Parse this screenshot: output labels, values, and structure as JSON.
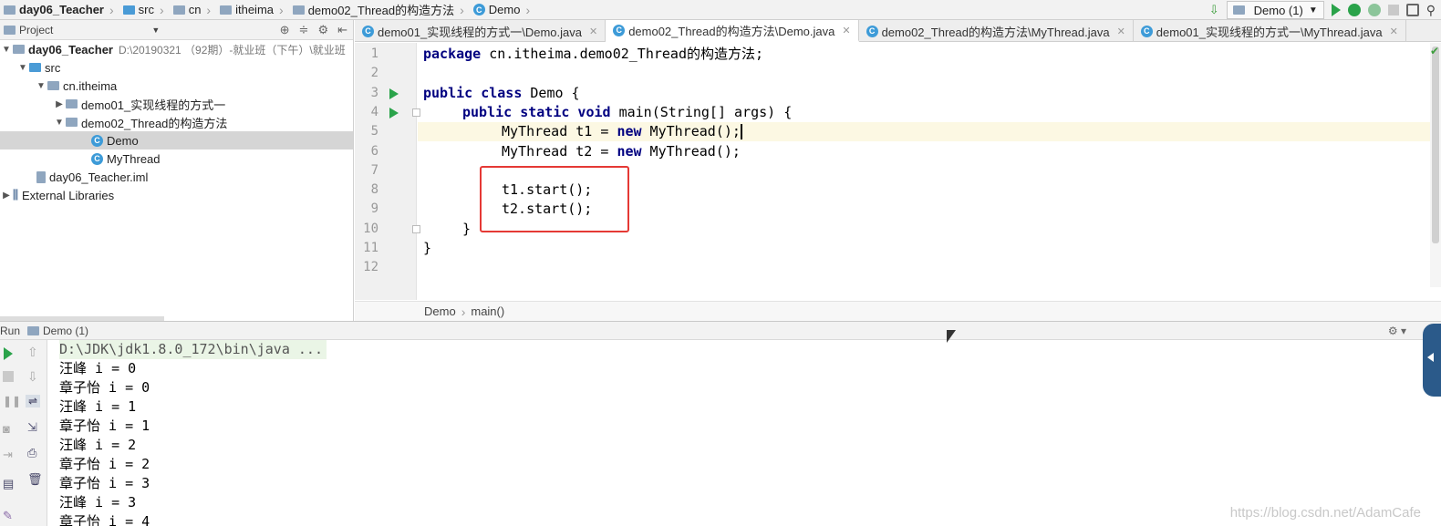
{
  "breadcrumb": {
    "items": [
      "day06_Teacher",
      "src",
      "cn",
      "itheima",
      "demo02_Thread的构造方法",
      "Demo"
    ]
  },
  "toolbar": {
    "run_config": "Demo (1)"
  },
  "project_panel": {
    "title": "Project",
    "tree": [
      {
        "label": "day06_Teacher",
        "path": "D:\\20190321 （92期）-就业班（下午）\\就业班"
      },
      {
        "label": "src"
      },
      {
        "label": "cn.itheima"
      },
      {
        "label": "demo01_实现线程的方式一"
      },
      {
        "label": "demo02_Thread的构造方法"
      },
      {
        "label": "Demo"
      },
      {
        "label": "MyThread"
      },
      {
        "label": "day06_Teacher.iml"
      },
      {
        "label": "External Libraries"
      }
    ]
  },
  "tabs": [
    {
      "label": "demo01_实现线程的方式一\\Demo.java"
    },
    {
      "label": "demo02_Thread的构造方法\\Demo.java"
    },
    {
      "label": "demo02_Thread的构造方法\\MyThread.java"
    },
    {
      "label": "demo01_实现线程的方式一\\MyThread.java"
    }
  ],
  "editor": {
    "line_numbers": [
      "1",
      "2",
      "3",
      "4",
      "5",
      "6",
      "7",
      "8",
      "9",
      "10",
      "11",
      "12"
    ],
    "lines": {
      "l1_kw": "package",
      "l1_rest": " cn.itheima.demo02_Thread的构造方法;",
      "l3_kw": "public class",
      "l3_rest": " Demo {",
      "l4_kw": "public static void",
      "l4_rest": " main(String[] args) {",
      "l5_a": "MyThread t1 = ",
      "l5_kw": "new",
      "l5_b": " MyThread();",
      "l6_a": "MyThread t2 = ",
      "l6_kw": "new",
      "l6_b": " MyThread();",
      "l8": "t1.start();",
      "l9": "t2.start();",
      "l10": "}",
      "l11": "}"
    },
    "breadcrumb": [
      "Demo",
      "main()"
    ]
  },
  "run_panel": {
    "label": "Run",
    "config": "Demo (1)",
    "output": [
      "D:\\JDK\\jdk1.8.0_172\\bin\\java ...",
      "汪峰 i = 0",
      "章子怡 i = 0",
      "汪峰 i = 1",
      "章子怡 i = 1",
      "汪峰 i = 2",
      "章子怡 i = 2",
      "章子怡 i = 3",
      "汪峰 i = 3",
      "章子怡 i = 4"
    ]
  },
  "watermark": "https://blog.csdn.net/AdamCafe"
}
